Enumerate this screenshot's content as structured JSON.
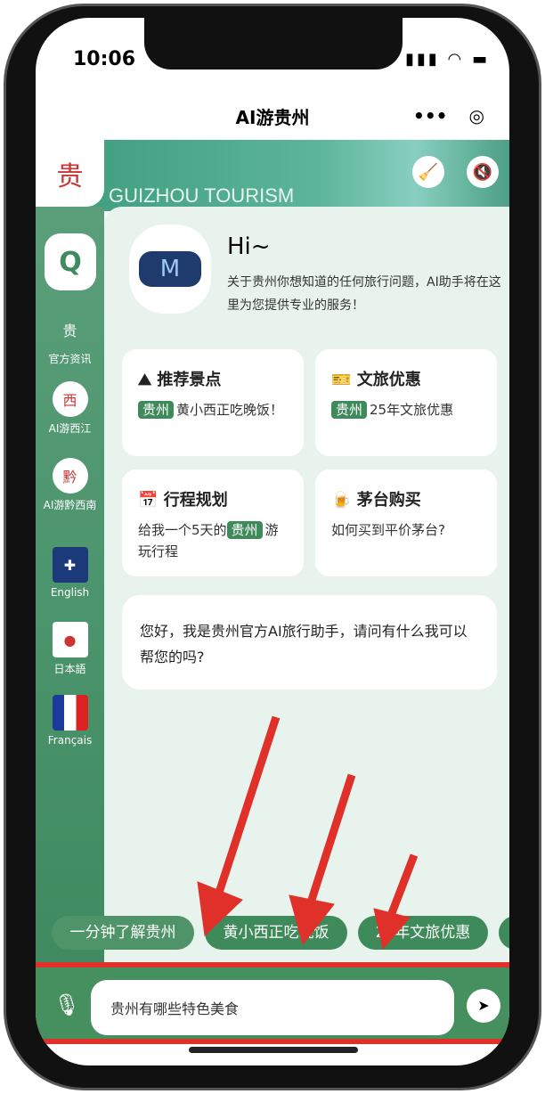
{
  "status": {
    "time": "10:06",
    "icons": [
      "signal-icon",
      "wifi-icon",
      "battery-icon"
    ]
  },
  "nav": {
    "title": "AI游贵州",
    "more": "•••",
    "target": "◎"
  },
  "banner": {
    "title": "GUIZHOU TOURISM",
    "clear_icon": "broom-icon",
    "mute_icon": "speaker-mute-icon"
  },
  "sidebar": {
    "items": [
      {
        "label": "官方资讯"
      },
      {
        "label": "AI游西江"
      },
      {
        "label": "AI游黔西南"
      },
      {
        "label": "English"
      },
      {
        "label": "日本語"
      },
      {
        "label": "Français"
      }
    ]
  },
  "welcome": {
    "hi": "Hi~",
    "intro": "关于贵州你想知道的任何旅行问题，AI助手将在这里为您提供专业的服务！"
  },
  "cards": [
    {
      "icon": "⛰",
      "title": "推荐景点",
      "tag": "贵州",
      "text": "黄小西正吃晚饭！"
    },
    {
      "icon": "🎫",
      "title": "文旅优惠",
      "tag": "贵州",
      "text": "25年文旅优惠"
    },
    {
      "icon": "📅",
      "title": "行程规划",
      "pre": "给我一个5天的",
      "tag": "贵州",
      "text": "游玩行程"
    },
    {
      "icon": "🍺",
      "title": "茅台购买",
      "text": "如何买到平价茅台?"
    }
  ],
  "greeting": "您好，我是贵州官方AI旅行助手，请问有什么我可以帮您的吗?",
  "chips": [
    "一分钟了解贵州",
    "黄小西正吃晚饭",
    "25年文旅优惠"
  ],
  "input": {
    "value": "贵州有哪些特色美食"
  },
  "colors": {
    "primary": "#3f8a5a",
    "annotation": "#e0302a",
    "background": "#e9f3ee"
  }
}
